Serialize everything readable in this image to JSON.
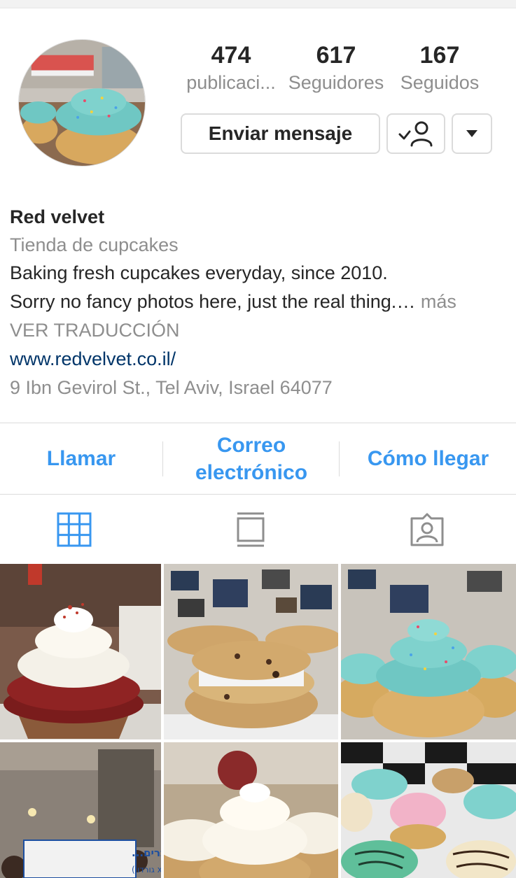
{
  "profile": {
    "stats": [
      {
        "value": "474",
        "label": "publicaci..."
      },
      {
        "value": "617",
        "label": "Seguidores"
      },
      {
        "value": "167",
        "label": "Seguidos"
      }
    ],
    "message_button": "Enviar mensaje",
    "follow_icon": "following-check-icon",
    "more_icon": "caret-down-icon"
  },
  "bio": {
    "name": "Red velvet",
    "category": "Tienda de cupcakes",
    "line1": "Baking fresh cupcakes everyday, since 2010.",
    "line2": "Sorry no fancy photos here, just the real thing.…",
    "more": " más",
    "translate": "VER TRADUCCIÓN",
    "website": "www.redvelvet.co.il/",
    "address": "9 Ibn Gevirol St., Tel Aviv, Israel 64077"
  },
  "contact": {
    "call": "Llamar",
    "email_line1": "Correo",
    "email_line2": "electrónico",
    "directions": "Cómo llegar"
  },
  "tabs": [
    {
      "icon": "grid-icon",
      "active": true
    },
    {
      "icon": "feed-icon",
      "active": false
    },
    {
      "icon": "tagged-icon",
      "active": false
    }
  ],
  "posts": [
    {
      "subject": "red-velvet-cupcake"
    },
    {
      "subject": "cookies"
    },
    {
      "subject": "mint-cupcakes"
    },
    {
      "subject": "shop-window-sign"
    },
    {
      "subject": "vanilla-cupcakes"
    },
    {
      "subject": "assorted-cupcakes"
    }
  ],
  "shop_sign": {
    "line1": "בקרוב עוברים...",
    "line2": "לדיזנגוף 134 (x גורדון)"
  },
  "colors": {
    "accent": "#3897f0",
    "link": "#003569",
    "muted": "#8e8e8e",
    "text": "#262626"
  }
}
